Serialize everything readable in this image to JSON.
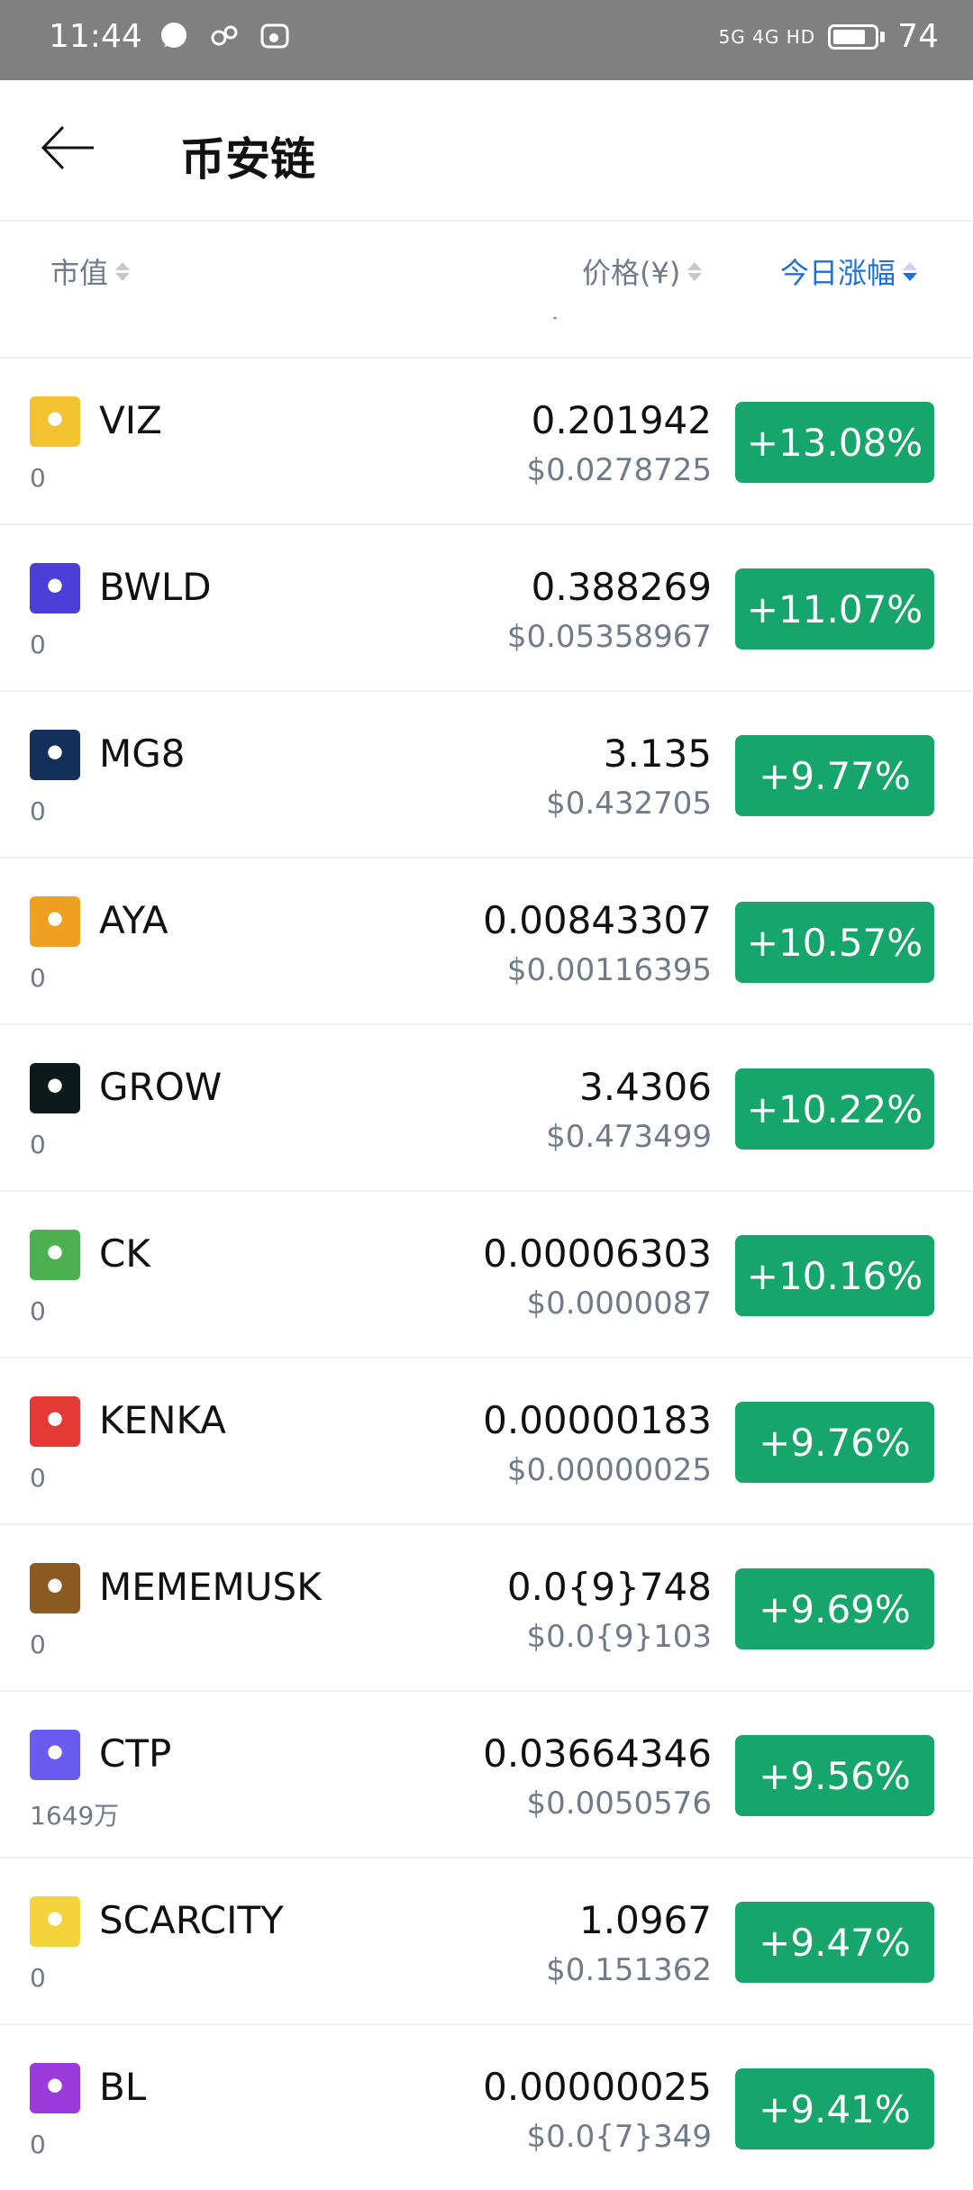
{
  "status": {
    "time": "11:44",
    "network": "5G 4G HD",
    "battery": "74"
  },
  "header": {
    "title": "币安链"
  },
  "sort": {
    "market_cap": "市值",
    "price": "价格(¥)",
    "change": "今日涨幅"
  },
  "rows": [
    {
      "name": "VIZ",
      "cap": "0",
      "price": "0.201942",
      "usd": "$0.0278725",
      "change": "+13.08%",
      "icon_color": "#f2c230"
    },
    {
      "name": "BWLD",
      "cap": "0",
      "price": "0.388269",
      "usd": "$0.05358967",
      "change": "+11.07%",
      "icon_color": "#4b3fd8"
    },
    {
      "name": "MG8",
      "cap": "0",
      "price": "3.135",
      "usd": "$0.432705",
      "change": "+9.77%",
      "icon_color": "#12305a"
    },
    {
      "name": "AYA",
      "cap": "0",
      "price": "0.00843307",
      "usd": "$0.00116395",
      "change": "+10.57%",
      "icon_color": "#f0a020"
    },
    {
      "name": "GROW",
      "cap": "0",
      "price": "3.4306",
      "usd": "$0.473499",
      "change": "+10.22%",
      "icon_color": "#0c1a1c"
    },
    {
      "name": "CK",
      "cap": "0",
      "price": "0.00006303",
      "usd": "$0.0000087",
      "change": "+10.16%",
      "icon_color": "#4caf50"
    },
    {
      "name": "KENKA",
      "cap": "0",
      "price": "0.00000183",
      "usd": "$0.00000025",
      "change": "+9.76%",
      "icon_color": "#e53935"
    },
    {
      "name": "MEMEMUSK",
      "cap": "0",
      "price": "0.0{9}748",
      "usd": "$0.0{9}103",
      "change": "+9.69%",
      "icon_color": "#8a5a22"
    },
    {
      "name": "CTP",
      "cap": "1649万",
      "price": "0.03664346",
      "usd": "$0.0050576",
      "change": "+9.56%",
      "icon_color": "#6a5cf0"
    },
    {
      "name": "SCARCITY",
      "cap": "0",
      "price": "1.0967",
      "usd": "$0.151362",
      "change": "+9.47%",
      "icon_color": "#f5d33c"
    },
    {
      "name": "BL",
      "cap": "0",
      "price": "0.00000025",
      "usd": "$0.0{7}349",
      "change": "+9.41%",
      "icon_color": "#9b3bdc"
    }
  ]
}
